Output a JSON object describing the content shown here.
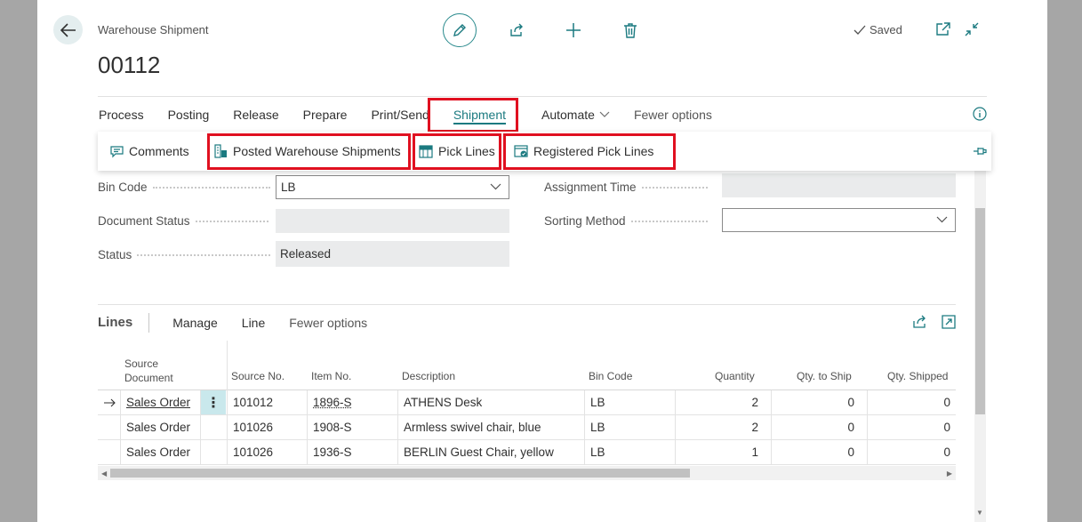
{
  "header": {
    "caption": "Warehouse Shipment",
    "title": "00112",
    "saved_label": "Saved"
  },
  "toolbar": {
    "icons": [
      "edit-icon",
      "share-icon",
      "new-icon",
      "delete-icon"
    ]
  },
  "action_bar": {
    "items": [
      "Process",
      "Posting",
      "Release",
      "Prepare",
      "Print/Send",
      "Shipment",
      "Automate",
      "Fewer options"
    ],
    "selected": "Shipment"
  },
  "shipment_menu": {
    "comments": "Comments",
    "posted_shipments": "Posted Warehouse Shipments",
    "pick_lines": "Pick Lines",
    "registered_pick_lines": "Registered Pick Lines"
  },
  "fields": {
    "bin_code": {
      "label": "Bin Code",
      "value": "LB"
    },
    "document_status": {
      "label": "Document Status",
      "value": ""
    },
    "status": {
      "label": "Status",
      "value": "Released"
    },
    "assignment_time": {
      "label": "Assignment Time",
      "value": ""
    },
    "sorting_method": {
      "label": "Sorting Method",
      "value": ""
    }
  },
  "lines": {
    "title": "Lines",
    "actions": [
      "Manage",
      "Line",
      "Fewer options"
    ],
    "columns": {
      "source_document_1": "Source",
      "source_document_2": "Document",
      "source_no": "Source No.",
      "item_no": "Item No.",
      "description": "Description",
      "bin_code": "Bin Code",
      "quantity": "Quantity",
      "qty_to_ship": "Qty. to Ship",
      "qty_shipped": "Qty. Shipped"
    },
    "rows": [
      {
        "source_document": "Sales Order",
        "source_no": "101012",
        "item_no": "1896-S",
        "description": "ATHENS Desk",
        "bin_code": "LB",
        "quantity": "2",
        "qty_to_ship": "0",
        "qty_shipped": "0"
      },
      {
        "source_document": "Sales Order",
        "source_no": "101026",
        "item_no": "1908-S",
        "description": "Armless swivel chair, blue",
        "bin_code": "LB",
        "quantity": "2",
        "qty_to_ship": "0",
        "qty_shipped": "0"
      },
      {
        "source_document": "Sales Order",
        "source_no": "101026",
        "item_no": "1936-S",
        "description": "BERLIN Guest Chair, yellow",
        "bin_code": "LB",
        "quantity": "1",
        "qty_to_ship": "0",
        "qty_shipped": "0"
      }
    ]
  },
  "colors": {
    "accent": "#1b7a80",
    "highlight": "#e01020"
  }
}
